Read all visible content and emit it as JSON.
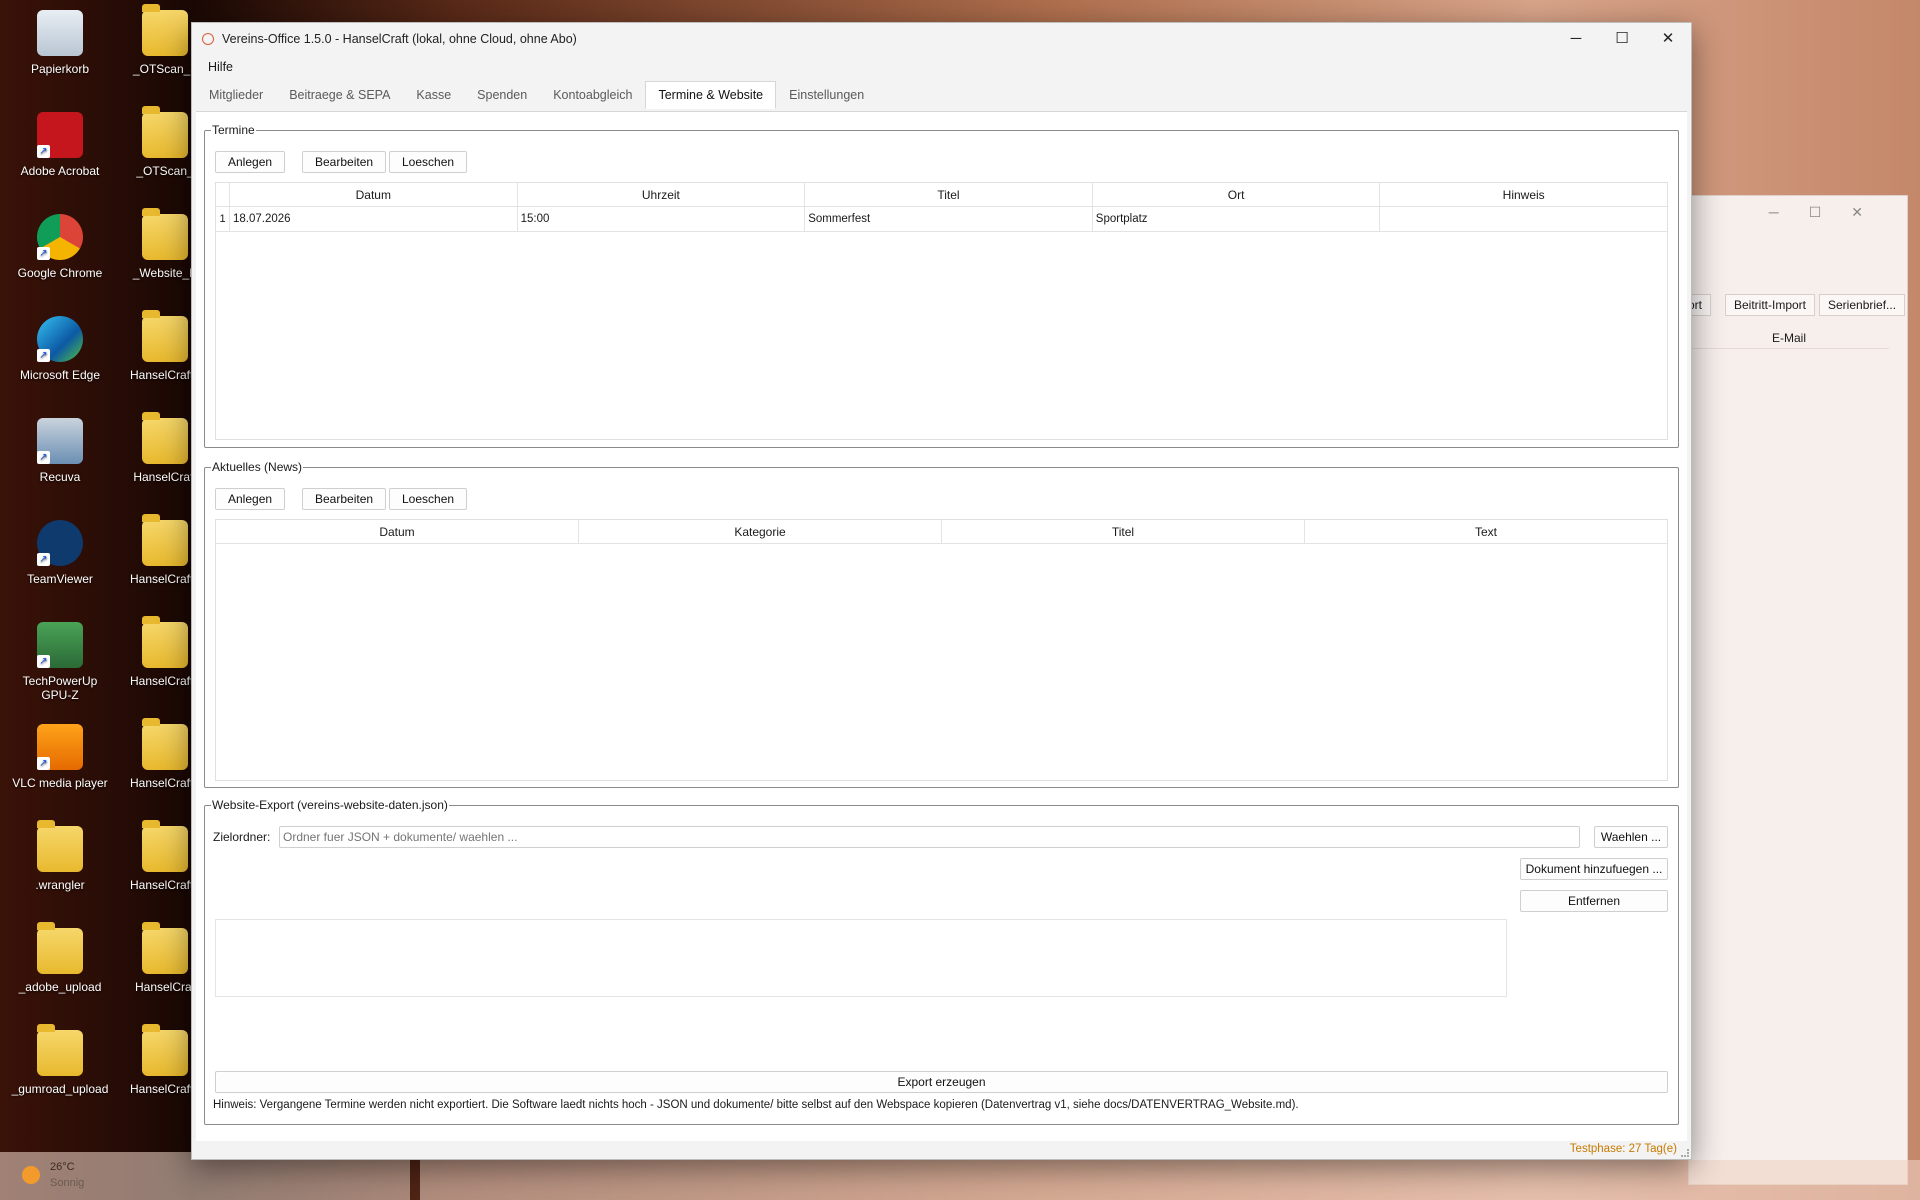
{
  "desktop": {
    "col1": [
      {
        "label": "Papierkorb",
        "icon": "recycle-bin-icon"
      },
      {
        "label": "Adobe Acrobat",
        "icon": "acrobat-icon"
      },
      {
        "label": "Google Chrome",
        "icon": "chrome-icon"
      },
      {
        "label": "Microsoft Edge",
        "icon": "edge-icon"
      },
      {
        "label": "Recuva",
        "icon": "recuva-icon"
      },
      {
        "label": "TeamViewer",
        "icon": "teamviewer-icon"
      },
      {
        "label": "TechPowerUp GPU-Z",
        "icon": "gpuz-icon"
      },
      {
        "label": "VLC media player",
        "icon": "vlc-icon"
      },
      {
        "label": ".wrangler",
        "icon": "folder-icon"
      },
      {
        "label": "_adobe_upload",
        "icon": "folder-icon"
      },
      {
        "label": "_gumroad_upload",
        "icon": "folder-icon"
      }
    ],
    "col2": [
      {
        "label": "_OTScan_a",
        "icon": "folder-icon"
      },
      {
        "label": "_OTScan_",
        "icon": "folder-icon"
      },
      {
        "label": "_Website_B",
        "icon": "folder-icon"
      },
      {
        "label": "HanselCraft_",
        "icon": "folder-icon"
      },
      {
        "label": "HanselCraft",
        "icon": "folder-icon"
      },
      {
        "label": "HanselCraft_",
        "icon": "folder-icon"
      },
      {
        "label": "HanselCraft_",
        "icon": "folder-icon"
      },
      {
        "label": "HanselCraft_",
        "icon": "folder-icon"
      },
      {
        "label": "HanselCraft_",
        "icon": "folder-icon"
      },
      {
        "label": "HanselCraf",
        "icon": "folder-icon"
      },
      {
        "label": "HanselCraft_",
        "icon": "folder-icon"
      }
    ]
  },
  "bg_window": {
    "buttons": [
      "ort",
      "Beitritt-Import",
      "Serienbrief..."
    ],
    "header": "E-Mail"
  },
  "taskbar": {
    "temperature": "26°C",
    "condition": "Sonnig"
  },
  "app": {
    "title": "Vereins-Office 1.5.0 - HanselCraft (lokal, ohne Cloud, ohne Abo)",
    "window_buttons": {
      "minimize": "─",
      "maximize": "☐",
      "close": "✕"
    },
    "menu": [
      "Hilfe"
    ],
    "tabs": [
      "Mitglieder",
      "Beitraege & SEPA",
      "Kasse",
      "Spenden",
      "Kontoabgleich",
      "Termine & Website",
      "Einstellungen"
    ],
    "active_tab": "Termine & Website",
    "termine": {
      "title": "Termine",
      "buttons": {
        "add": "Anlegen",
        "edit": "Bearbeiten",
        "delete": "Loeschen"
      },
      "columns": [
        "Datum",
        "Uhrzeit",
        "Titel",
        "Ort",
        "Hinweis"
      ],
      "rows": [
        {
          "num": "1",
          "datum": "18.07.2026",
          "uhrzeit": "15:00",
          "titel": "Sommerfest",
          "ort": "Sportplatz",
          "hinweis": ""
        }
      ]
    },
    "news": {
      "title": "Aktuelles (News)",
      "buttons": {
        "add": "Anlegen",
        "edit": "Bearbeiten",
        "delete": "Loeschen"
      },
      "columns": [
        "Datum",
        "Kategorie",
        "Titel",
        "Text"
      ]
    },
    "export": {
      "title": "Website-Export (vereins-website-daten.json)",
      "target_label": "Zielordner:",
      "target_placeholder": "Ordner fuer JSON + dokumente/ waehlen ...",
      "target_value": "",
      "choose_button": "Waehlen ...",
      "add_doc_button": "Dokument hinzufuegen ...",
      "remove_button": "Entfernen",
      "export_button": "Export erzeugen",
      "hint": "Hinweis: Vergangene Termine werden nicht exportiert. Die Software laedt nichts hoch - JSON und dokumente/ bitte selbst auf den Webspace kopieren (Datenvertrag v1, siehe docs/DATENVERTRAG_Website.md)."
    },
    "status": "Testphase: 27 Tag(e)"
  },
  "colors": {
    "accent_status": "#c87a00",
    "close_icon": "#e05a3a"
  }
}
